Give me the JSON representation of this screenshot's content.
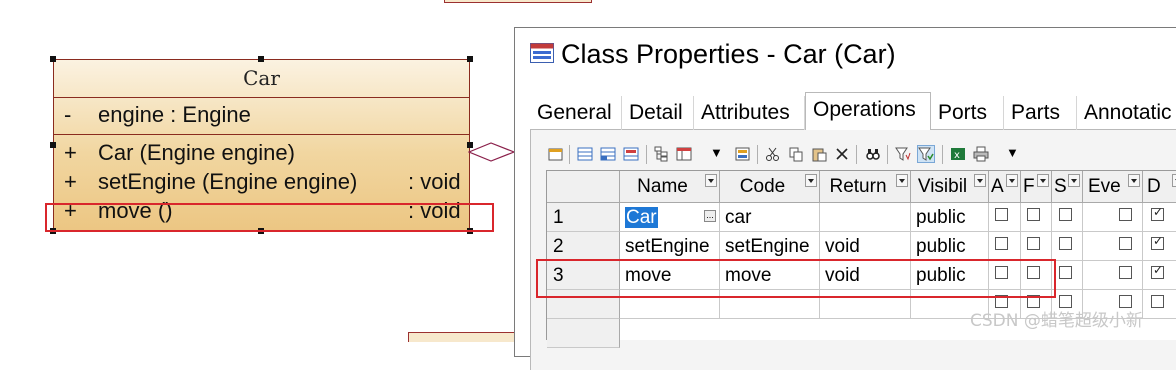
{
  "uml": {
    "class_name": "Car",
    "attribute": {
      "visibility": "-",
      "text": "engine   : Engine"
    },
    "operations": [
      {
        "visibility": "+",
        "signature": "Car (Engine engine)",
        "return": ""
      },
      {
        "visibility": "+",
        "signature": "setEngine (Engine engine)",
        "return": ": void"
      },
      {
        "visibility": "+",
        "signature": "move ()",
        "return": ": void"
      }
    ]
  },
  "dialog": {
    "title": "Class Properties - Car (Car)",
    "tabs": [
      "General",
      "Detail",
      "Attributes",
      "Operations",
      "Ports",
      "Parts",
      "Annotatic"
    ],
    "active_tab": "Operations"
  },
  "grid": {
    "columns": [
      "Name",
      "Code",
      "Return",
      "Visibil",
      "A",
      "F",
      "S",
      "Eve",
      "D"
    ],
    "rows": [
      {
        "index": "1",
        "name": "Car",
        "code": "car",
        "return": "",
        "visibility": "public",
        "checks": [
          false,
          false,
          false,
          false,
          true
        ]
      },
      {
        "index": "2",
        "name": "setEngine",
        "code": "setEngine",
        "return": "void",
        "visibility": "public",
        "checks": [
          false,
          false,
          false,
          false,
          true
        ]
      },
      {
        "index": "3",
        "name": "move",
        "code": "move",
        "return": "void",
        "visibility": "public",
        "checks": [
          false,
          false,
          false,
          false,
          true
        ]
      }
    ]
  },
  "colors": {
    "highlight_border": "#d9262c",
    "uml_border": "#8a2b1f",
    "selection": "#1e78d6"
  },
  "watermark": "CSDN @蜡笔超级小新"
}
